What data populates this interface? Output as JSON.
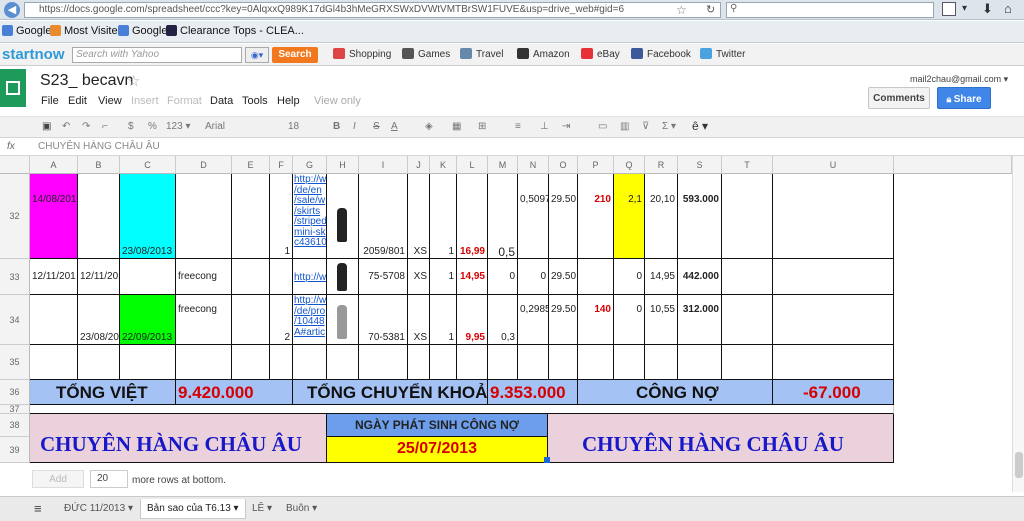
{
  "browser": {
    "url": "https://docs.google.com/spreadsheet/ccc?key=0AlqxxQ989K17dGl4b3hMeGRXSWxDVWtVMTBrSW1FUVE&usp=drive_web#gid=6",
    "bookmarks": [
      "Google",
      "Most Visited",
      "Google",
      "Clearance Tops - CLEA..."
    ]
  },
  "toolbar_yahoo": {
    "brand": "startnow",
    "search_placeholder": "Search with Yahoo",
    "search_button": "Search",
    "links": [
      "Shopping",
      "Games",
      "Travel",
      "Amazon",
      "eBay",
      "Facebook",
      "Twitter"
    ]
  },
  "doc": {
    "title": "S23_ becavn",
    "star": "☆",
    "user_email": "mail2chau@gmail.com ▾",
    "comments_label": "Comments",
    "share_label": "Share",
    "menu": [
      "File",
      "Edit",
      "View",
      "Insert",
      "Format",
      "Data",
      "Tools",
      "Help",
      "View only"
    ]
  },
  "format_toolbar": {
    "percent": "%",
    "numfmt": "123 ▾",
    "font": "Arial",
    "font_size": "18",
    "more": "ê ▾"
  },
  "formula": {
    "fx": "fx",
    "content": "CHUYÊN HÀNG CHÂU ÂU"
  },
  "columns": [
    "A",
    "B",
    "C",
    "D",
    "E",
    "F",
    "G",
    "H",
    "I",
    "J",
    "K",
    "L",
    "M",
    "N",
    "O",
    "P",
    "Q",
    "R",
    "S",
    "T",
    "U"
  ],
  "rows": {
    "r32": {
      "num": "32",
      "a": "14/08/201",
      "c": "23/08/2013",
      "f": "1",
      "link": "http://w\n/de/en\n/sale/w\n/skirts\n/striped\nmini-sk\nc43610",
      "i": "2059/801",
      "j": "XS",
      "k": "1",
      "l": "16,99",
      "m": "0,5",
      "n": "0,5097",
      "o": "29.50",
      "p": "210",
      "q": "2,1",
      "r": "20,10",
      "s": "593.000"
    },
    "r33": {
      "num": "33",
      "a": "12/11/201",
      "b": "12/11/201",
      "d": "freecong",
      "link": "http://w\n/de/pro\n/13265",
      "i": "75-5708",
      "j": "XS",
      "k": "1",
      "l": "14,95",
      "m": "0",
      "n": "0",
      "o": "29.50",
      "q": "0",
      "r": "14,95",
      "s": "442.000"
    },
    "r34": {
      "num": "34",
      "b": "23/08/201",
      "c": "22/09/2013",
      "d": "freecong",
      "f": "2",
      "link": "http://w\n/de/pro\n/10448\nA#artic",
      "i": "70-5381",
      "j": "XS",
      "k": "1",
      "l": "9,95",
      "m": "0,3",
      "n": "0,2985",
      "o": "29.50",
      "p": "140",
      "q": "0",
      "r": "10,55",
      "s": "312.000"
    },
    "r35": {
      "num": "35"
    },
    "r36": {
      "num": "36",
      "tong_viet": "TỔNG VIỆT",
      "tong_viet_val": "9.420.000",
      "tong_ck": "TỔNG CHUYỂN KHOẢN",
      "tong_ck_val": "9.353.000",
      "cong_no": "CÔNG NỢ",
      "cong_no_val": "-67.000"
    },
    "r37": {
      "num": "37"
    },
    "r38": {
      "num": "38",
      "left": "CHUYÊN HÀNG CHÂU ÂU",
      "mid_title": "NGÀY PHÁT SINH CÔNG NỢ",
      "right": "CHUYÊN HÀNG CHÂU ÂU"
    },
    "r39": {
      "num": "39",
      "mid_date": "25/07/2013"
    }
  },
  "add_rows": {
    "button": "Add",
    "count": "20",
    "label": "more rows at bottom."
  },
  "sheets": [
    "ĐỨC 11/2013",
    "Bản sao của T6.13",
    "LÊ",
    "Buôn"
  ],
  "colors": {
    "magenta": "#ff00ff",
    "cyan": "#00ffff",
    "green": "#00ff00",
    "yellow": "#ffff00",
    "summary": "#a4c2f4",
    "pink": "#ead1dc",
    "blue_box": "#6d9eeb",
    "red": "#d60000"
  }
}
